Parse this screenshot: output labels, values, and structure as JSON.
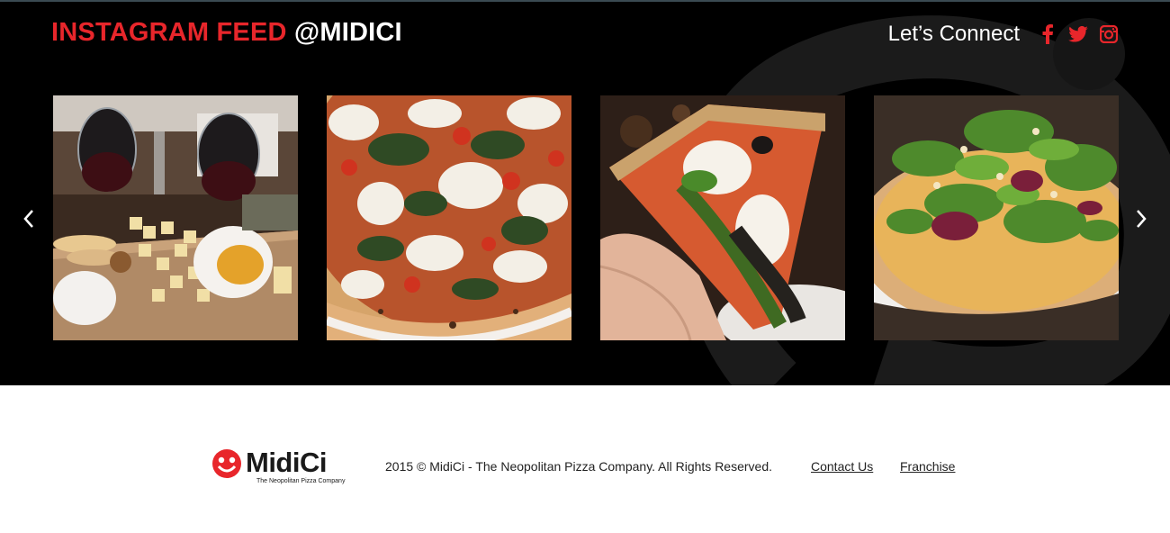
{
  "feed": {
    "title_red": "INSTAGRAM FEED",
    "title_white": "@MIDICI",
    "connect_label": "Let’s Connect",
    "social": [
      {
        "name": "facebook",
        "icon": "facebook-icon"
      },
      {
        "name": "twitter",
        "icon": "twitter-icon"
      },
      {
        "name": "instagram",
        "icon": "instagram-icon"
      }
    ],
    "photos": [
      {
        "subject": "cheese-board-and-wine"
      },
      {
        "subject": "pesto-tomato-pizza"
      },
      {
        "subject": "pizza-slice-in-hand"
      },
      {
        "subject": "arugula-salad-pizza"
      }
    ],
    "prev_icon": "chevron-left-icon",
    "next_icon": "chevron-right-icon"
  },
  "footer": {
    "logo_word": "MidiCi",
    "logo_tagline": "The Neopolitan Pizza Company",
    "copyright": "2015 © MidiCi - The Neopolitan Pizza Company. All Rights Reserved.",
    "links": {
      "contact": "Contact Us",
      "franchise": "Franchise"
    }
  },
  "colors": {
    "brand_red": "#e8262b",
    "feed_bg": "#000000",
    "footer_bg": "#ffffff"
  }
}
